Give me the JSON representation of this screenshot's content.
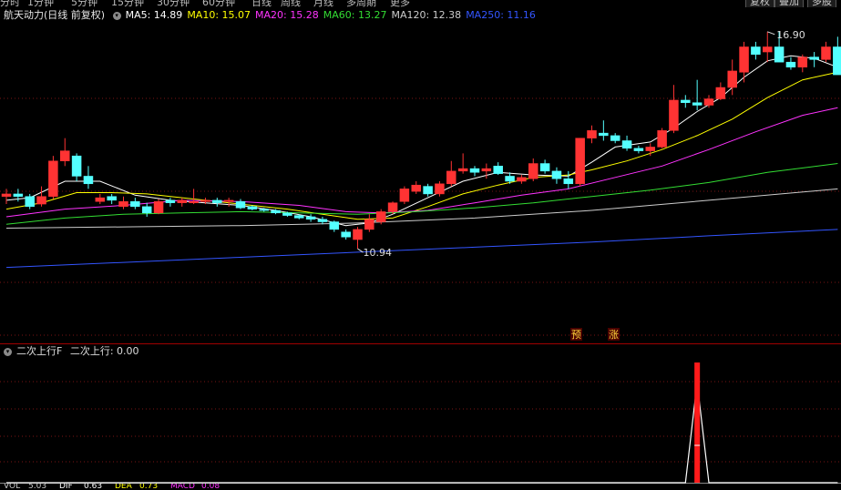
{
  "periods": [
    "分时",
    "1分钟",
    "5分钟",
    "15分钟",
    "30分钟",
    "60分钟",
    "日线",
    "周线",
    "月线",
    "多周期",
    "更多"
  ],
  "top_buttons": [
    "复权",
    "叠加",
    "多股"
  ],
  "main_legend": {
    "title": "航天动力(日线 前复权)",
    "ma": [
      {
        "text": "MA5: 14.89",
        "color": "#ffffff"
      },
      {
        "text": "MA10: 15.07",
        "color": "#ffff00"
      },
      {
        "text": "MA20: 15.28",
        "color": "#ff33ff"
      },
      {
        "text": "MA60: 13.27",
        "color": "#33dd33"
      },
      {
        "text": "MA120: 12.38",
        "color": "#cccccc"
      },
      {
        "text": "MA250: 11.16",
        "color": "#3355ff"
      }
    ]
  },
  "annotations": {
    "high_label": "16.90",
    "low_label": "10.94",
    "tag_pre": "预",
    "tag_rise": "涨"
  },
  "sub_legend": {
    "name": "二次上行F",
    "value_text": "二次上行: 0.00"
  },
  "bottom_status": [
    "VOL",
    "5.03",
    "DIF",
    "0.63",
    "DEA",
    "0.73",
    "MACD",
    "0.08"
  ],
  "colors": {
    "up": "#ff3333",
    "down": "#54ffff",
    "grid": "#7a1515",
    "separator": "#a00000"
  },
  "chart_data": {
    "type": "candlestick",
    "ohlc": [
      [
        13.0,
        13.3,
        12.7,
        13.1
      ],
      [
        13.1,
        13.3,
        12.8,
        13.0
      ],
      [
        13.0,
        13.1,
        12.5,
        12.6
      ],
      [
        12.7,
        13.4,
        12.6,
        13.0
      ],
      [
        13.0,
        14.6,
        12.9,
        14.4
      ],
      [
        14.4,
        15.3,
        14.2,
        14.8
      ],
      [
        14.6,
        14.7,
        13.6,
        13.8
      ],
      [
        13.8,
        14.2,
        13.3,
        13.5
      ],
      [
        12.8,
        13.1,
        12.7,
        12.95
      ],
      [
        13.0,
        13.1,
        12.7,
        12.85
      ],
      [
        12.6,
        13.0,
        12.5,
        12.8
      ],
      [
        12.8,
        12.95,
        12.5,
        12.6
      ],
      [
        12.6,
        12.75,
        12.2,
        12.35
      ],
      [
        12.35,
        12.9,
        12.3,
        12.8
      ],
      [
        12.85,
        12.95,
        12.6,
        12.75
      ],
      [
        12.75,
        12.95,
        12.6,
        12.85
      ],
      [
        12.8,
        13.3,
        12.7,
        12.8
      ],
      [
        12.8,
        12.95,
        12.7,
        12.85
      ],
      [
        12.85,
        12.95,
        12.6,
        12.75
      ],
      [
        12.8,
        12.95,
        12.6,
        12.85
      ],
      [
        12.8,
        12.9,
        12.5,
        12.55
      ],
      [
        12.6,
        12.65,
        12.45,
        12.5
      ],
      [
        12.5,
        12.55,
        12.4,
        12.45
      ],
      [
        12.45,
        12.5,
        12.3,
        12.35
      ],
      [
        12.35,
        12.4,
        12.2,
        12.25
      ],
      [
        12.25,
        12.3,
        12.1,
        12.15
      ],
      [
        12.2,
        12.3,
        12.0,
        12.1
      ],
      [
        12.1,
        12.2,
        11.9,
        12.0
      ],
      [
        12.0,
        12.05,
        11.6,
        11.7
      ],
      [
        11.6,
        11.7,
        11.3,
        11.4
      ],
      [
        11.3,
        11.8,
        10.94,
        11.7
      ],
      [
        11.7,
        12.3,
        11.6,
        12.1
      ],
      [
        12.0,
        12.5,
        11.9,
        12.4
      ],
      [
        12.4,
        12.8,
        12.3,
        12.75
      ],
      [
        12.8,
        13.4,
        12.7,
        13.3
      ],
      [
        13.2,
        13.6,
        13.1,
        13.45
      ],
      [
        13.4,
        13.5,
        13.0,
        13.1
      ],
      [
        13.1,
        13.6,
        13.0,
        13.5
      ],
      [
        13.5,
        14.4,
        13.4,
        14.0
      ],
      [
        14.0,
        14.7,
        13.9,
        14.1
      ],
      [
        14.1,
        14.2,
        13.8,
        13.95
      ],
      [
        14.0,
        14.3,
        13.7,
        14.1
      ],
      [
        14.2,
        14.35,
        13.85,
        13.9
      ],
      [
        13.8,
        13.95,
        13.5,
        13.6
      ],
      [
        13.6,
        13.85,
        13.5,
        13.75
      ],
      [
        13.7,
        14.5,
        13.6,
        14.3
      ],
      [
        14.3,
        14.45,
        13.9,
        14.0
      ],
      [
        14.0,
        14.15,
        13.5,
        13.7
      ],
      [
        13.7,
        14.0,
        13.3,
        13.5
      ],
      [
        13.5,
        15.3,
        13.4,
        15.3
      ],
      [
        15.3,
        15.8,
        15.1,
        15.6
      ],
      [
        15.5,
        16.0,
        15.2,
        15.4
      ],
      [
        15.4,
        15.5,
        15.1,
        15.2
      ],
      [
        15.2,
        15.4,
        14.8,
        14.9
      ],
      [
        14.9,
        15.0,
        14.7,
        14.8
      ],
      [
        14.8,
        15.1,
        14.6,
        14.95
      ],
      [
        14.95,
        15.7,
        14.9,
        15.6
      ],
      [
        15.6,
        17.4,
        15.5,
        16.8
      ],
      [
        16.8,
        17.0,
        16.5,
        16.7
      ],
      [
        16.7,
        17.6,
        16.4,
        16.6
      ],
      [
        16.6,
        17.0,
        16.5,
        16.85
      ],
      [
        16.85,
        17.5,
        16.8,
        17.3
      ],
      [
        17.3,
        18.4,
        17.0,
        17.95
      ],
      [
        17.9,
        19.1,
        17.5,
        18.9
      ],
      [
        18.9,
        19.1,
        18.4,
        18.6
      ],
      [
        18.7,
        19.5,
        18.3,
        18.9
      ],
      [
        18.9,
        19.5,
        18.4,
        18.3
      ],
      [
        18.3,
        18.5,
        18.0,
        18.1
      ],
      [
        18.1,
        18.6,
        17.9,
        18.5
      ],
      [
        18.5,
        18.7,
        18.1,
        18.4
      ],
      [
        18.4,
        19.1,
        18.3,
        18.9
      ],
      [
        18.9,
        19.3,
        18.6,
        17.8
      ]
    ],
    "ma_series": [
      {
        "name": "MA5",
        "color": "#ffffff",
        "points": [
          [
            0,
            12.85
          ],
          [
            2,
            12.95
          ],
          [
            5,
            13.6
          ],
          [
            8,
            13.6
          ],
          [
            11,
            13.05
          ],
          [
            14,
            12.85
          ],
          [
            17,
            12.75
          ],
          [
            20,
            12.65
          ],
          [
            23,
            12.45
          ],
          [
            26,
            12.2
          ],
          [
            29,
            11.85
          ],
          [
            31,
            11.95
          ],
          [
            33,
            12.3
          ],
          [
            36,
            12.95
          ],
          [
            39,
            13.6
          ],
          [
            42,
            13.95
          ],
          [
            45,
            13.85
          ],
          [
            48,
            13.8
          ],
          [
            50,
            14.35
          ],
          [
            52,
            14.95
          ],
          [
            55,
            15.15
          ],
          [
            57,
            15.7
          ],
          [
            59,
            16.35
          ],
          [
            61,
            16.9
          ],
          [
            63,
            17.7
          ],
          [
            65,
            18.35
          ],
          [
            67,
            18.55
          ],
          [
            69,
            18.45
          ],
          [
            71,
            18.1
          ]
        ]
      },
      {
        "name": "MA10",
        "color": "#ffff00",
        "points": [
          [
            0,
            12.5
          ],
          [
            3,
            12.75
          ],
          [
            6,
            13.15
          ],
          [
            9,
            13.15
          ],
          [
            12,
            13.1
          ],
          [
            15,
            12.95
          ],
          [
            18,
            12.8
          ],
          [
            21,
            12.65
          ],
          [
            24,
            12.5
          ],
          [
            27,
            12.3
          ],
          [
            30,
            12.1
          ],
          [
            33,
            12.15
          ],
          [
            36,
            12.6
          ],
          [
            39,
            13.1
          ],
          [
            42,
            13.45
          ],
          [
            45,
            13.75
          ],
          [
            48,
            13.85
          ],
          [
            50,
            14.05
          ],
          [
            53,
            14.4
          ],
          [
            56,
            14.85
          ],
          [
            59,
            15.4
          ],
          [
            62,
            16.05
          ],
          [
            65,
            16.9
          ],
          [
            68,
            17.6
          ],
          [
            71,
            17.9
          ]
        ]
      },
      {
        "name": "MA20",
        "color": "#ff33ff",
        "points": [
          [
            0,
            12.2
          ],
          [
            5,
            12.5
          ],
          [
            10,
            12.65
          ],
          [
            15,
            12.85
          ],
          [
            20,
            12.8
          ],
          [
            25,
            12.65
          ],
          [
            29,
            12.4
          ],
          [
            32,
            12.35
          ],
          [
            36,
            12.45
          ],
          [
            40,
            12.75
          ],
          [
            44,
            13.05
          ],
          [
            48,
            13.3
          ],
          [
            52,
            13.75
          ],
          [
            56,
            14.2
          ],
          [
            60,
            14.85
          ],
          [
            64,
            15.55
          ],
          [
            68,
            16.2
          ],
          [
            71,
            16.5
          ]
        ]
      },
      {
        "name": "MA60",
        "color": "#33dd33",
        "points": [
          [
            0,
            11.9
          ],
          [
            5,
            12.15
          ],
          [
            10,
            12.3
          ],
          [
            15,
            12.35
          ],
          [
            20,
            12.4
          ],
          [
            25,
            12.35
          ],
          [
            30,
            12.3
          ],
          [
            35,
            12.4
          ],
          [
            40,
            12.55
          ],
          [
            45,
            12.75
          ],
          [
            50,
            13.0
          ],
          [
            55,
            13.25
          ],
          [
            60,
            13.55
          ],
          [
            65,
            13.95
          ],
          [
            71,
            14.3
          ]
        ]
      },
      {
        "name": "MA120",
        "color": "#cccccc",
        "points": [
          [
            0,
            11.75
          ],
          [
            10,
            11.8
          ],
          [
            20,
            11.85
          ],
          [
            30,
            11.95
          ],
          [
            40,
            12.15
          ],
          [
            50,
            12.45
          ],
          [
            60,
            12.85
          ],
          [
            71,
            13.3
          ]
        ]
      },
      {
        "name": "MA250",
        "color": "#3355ff",
        "points": [
          [
            0,
            10.2
          ],
          [
            10,
            10.4
          ],
          [
            20,
            10.6
          ],
          [
            30,
            10.8
          ],
          [
            40,
            11.0
          ],
          [
            50,
            11.2
          ],
          [
            60,
            11.45
          ],
          [
            71,
            11.7
          ]
        ]
      }
    ],
    "y_range": [
      9.9,
      19.6
    ],
    "indicator": {
      "name": "二次上行",
      "values": [
        0,
        0,
        0,
        0,
        0,
        0,
        0,
        0,
        0,
        0,
        0,
        0,
        0,
        0,
        0,
        0,
        0,
        0,
        0,
        0,
        0,
        0,
        0,
        0,
        0,
        0,
        0,
        0,
        0,
        0,
        0,
        0,
        0,
        0,
        0,
        0,
        0,
        0,
        0,
        0,
        0,
        0,
        0,
        0,
        0,
        0,
        0,
        0,
        0,
        0,
        0,
        0,
        0,
        0,
        0,
        0,
        0,
        0,
        0,
        1,
        0,
        0,
        0,
        0,
        0,
        0,
        0,
        0,
        0,
        0,
        0,
        0
      ]
    }
  }
}
